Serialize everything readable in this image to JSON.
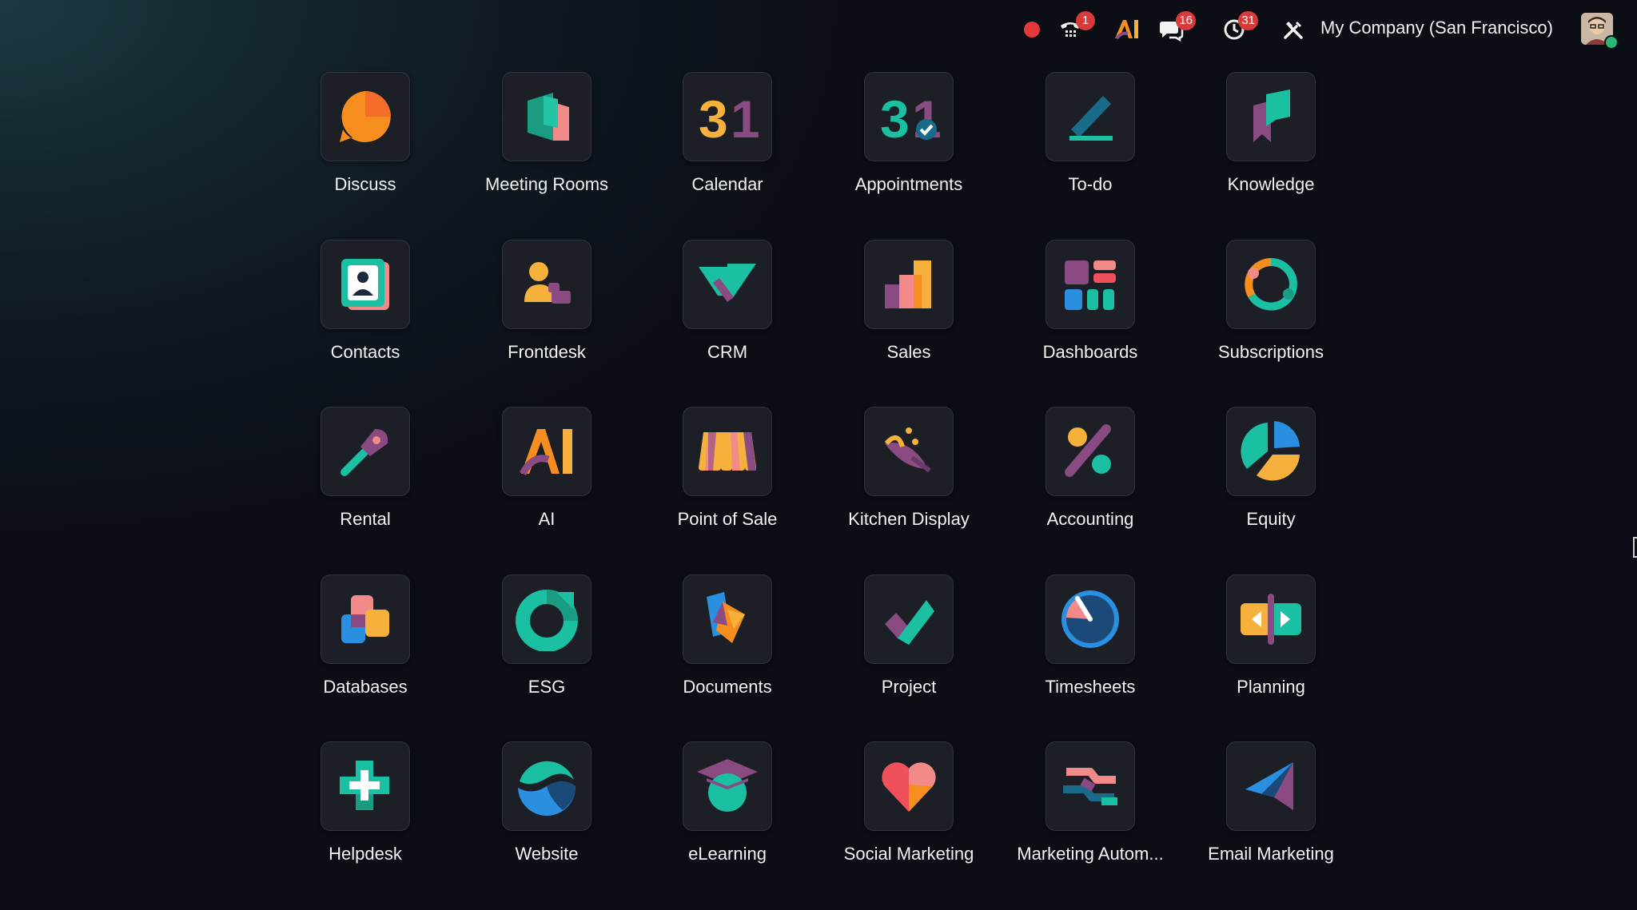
{
  "topbar": {
    "record_indicator": "record-dot-icon",
    "phone_badge": "1",
    "messages_badge": "16",
    "activities_badge": "31",
    "company_name": "My Company (San Francisco)",
    "ai_label": "AI"
  },
  "colors": {
    "badge": "#d83a3a",
    "record": "#e5383b",
    "tile": "#1c1f26",
    "teal": "#1bbfa1",
    "orange": "#f58e1e",
    "purple": "#8a4a82",
    "pink": "#f28a8a",
    "blue": "#2a8fe0",
    "yellow": "#f6b13d"
  },
  "apps": [
    {
      "label": "Discuss",
      "icon": "discuss-icon"
    },
    {
      "label": "Meeting Rooms",
      "icon": "meeting-rooms-icon"
    },
    {
      "label": "Calendar",
      "icon": "calendar-icon",
      "glyph": "31"
    },
    {
      "label": "Appointments",
      "icon": "appointments-icon",
      "glyph": "31"
    },
    {
      "label": "To-do",
      "icon": "todo-icon"
    },
    {
      "label": "Knowledge",
      "icon": "knowledge-icon"
    },
    {
      "label": "Contacts",
      "icon": "contacts-icon"
    },
    {
      "label": "Frontdesk",
      "icon": "frontdesk-icon"
    },
    {
      "label": "CRM",
      "icon": "crm-icon"
    },
    {
      "label": "Sales",
      "icon": "sales-icon"
    },
    {
      "label": "Dashboards",
      "icon": "dashboards-icon"
    },
    {
      "label": "Subscriptions",
      "icon": "subscriptions-icon"
    },
    {
      "label": "Rental",
      "icon": "rental-icon"
    },
    {
      "label": "AI",
      "icon": "ai-icon",
      "glyph": "AI"
    },
    {
      "label": "Point of Sale",
      "icon": "point-of-sale-icon"
    },
    {
      "label": "Kitchen Display",
      "icon": "kitchen-display-icon"
    },
    {
      "label": "Accounting",
      "icon": "accounting-icon"
    },
    {
      "label": "Equity",
      "icon": "equity-icon"
    },
    {
      "label": "Databases",
      "icon": "databases-icon"
    },
    {
      "label": "ESG",
      "icon": "esg-icon"
    },
    {
      "label": "Documents",
      "icon": "documents-icon"
    },
    {
      "label": "Project",
      "icon": "project-icon"
    },
    {
      "label": "Timesheets",
      "icon": "timesheets-icon"
    },
    {
      "label": "Planning",
      "icon": "planning-icon"
    },
    {
      "label": "Helpdesk",
      "icon": "helpdesk-icon"
    },
    {
      "label": "Website",
      "icon": "website-icon"
    },
    {
      "label": "eLearning",
      "icon": "elearning-icon"
    },
    {
      "label": "Social Marketing",
      "icon": "social-marketing-icon"
    },
    {
      "label": "Marketing Autom...",
      "icon": "marketing-automation-icon"
    },
    {
      "label": "Email Marketing",
      "icon": "email-marketing-icon"
    }
  ]
}
